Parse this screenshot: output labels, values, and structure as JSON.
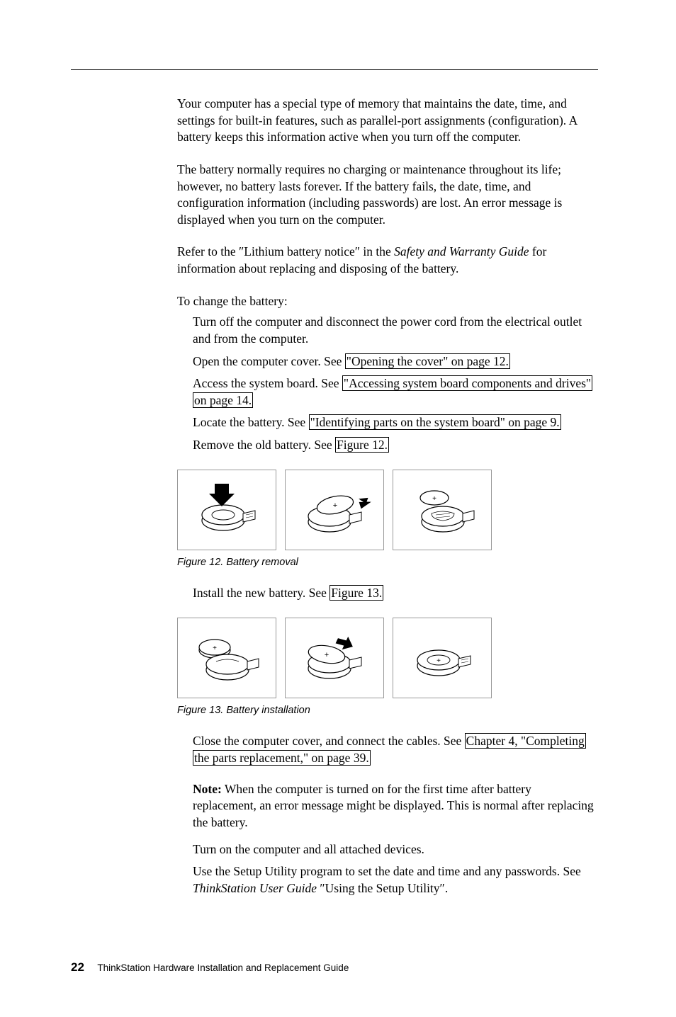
{
  "para1": "Your computer has a special type of memory that maintains the date, time, and settings for built-in features, such as parallel-port assignments (configuration). A battery keeps this information active when you turn off the computer.",
  "para2": "The battery normally requires no charging or maintenance throughout its life; however, no battery lasts forever. If the battery fails, the date, time, and configuration information (including passwords) are lost. An error message is displayed when you turn on the computer.",
  "para3_pre": "Refer to the ″Lithium battery notice″ in the ",
  "para3_em": "Safety and Warranty Guide",
  "para3_post": " for information about replacing and disposing of the battery.",
  "para4": "To change the battery:",
  "step1": "Turn off the computer and disconnect the power cord from the electrical outlet and from the computer.",
  "step2_pre": "Open the computer cover. See ",
  "step2_link": "\"Opening the cover\" on page 12.",
  "step3_pre": "Access the system board. See ",
  "step3_link1": "\"Accessing system board components and drives\"",
  "step3_link2": "on page 14.",
  "step4_pre": "Locate the battery. See ",
  "step4_link": "\"Identifying parts on the system board\" on page 9.",
  "step5_pre": "Remove the old battery. See ",
  "step5_link": "Figure 12.",
  "fig12_caption": "Figure 12. Battery removal",
  "step6_pre": "Install the new battery. See ",
  "step6_link": "Figure 13.",
  "fig13_caption": "Figure 13. Battery installation",
  "step7_pre": "Close the computer cover, and connect the cables. See ",
  "step7_link1": "Chapter 4, \"Completing",
  "step7_link2": "the parts replacement,\" on page 39.",
  "note_label": "Note:",
  "note_body": " When the computer is turned on for the first time after battery replacement, an error message might be displayed. This is normal after replacing the battery.",
  "step8": "Turn on the computer and all attached devices.",
  "step9_pre": "Use the Setup Utility program to set the date and time and any passwords. See ",
  "step9_em": "ThinkStation User Guide",
  "step9_post": " ″Using the Setup Utility″.",
  "page_number": "22",
  "book_title": "ThinkStation Hardware Installation and Replacement Guide"
}
